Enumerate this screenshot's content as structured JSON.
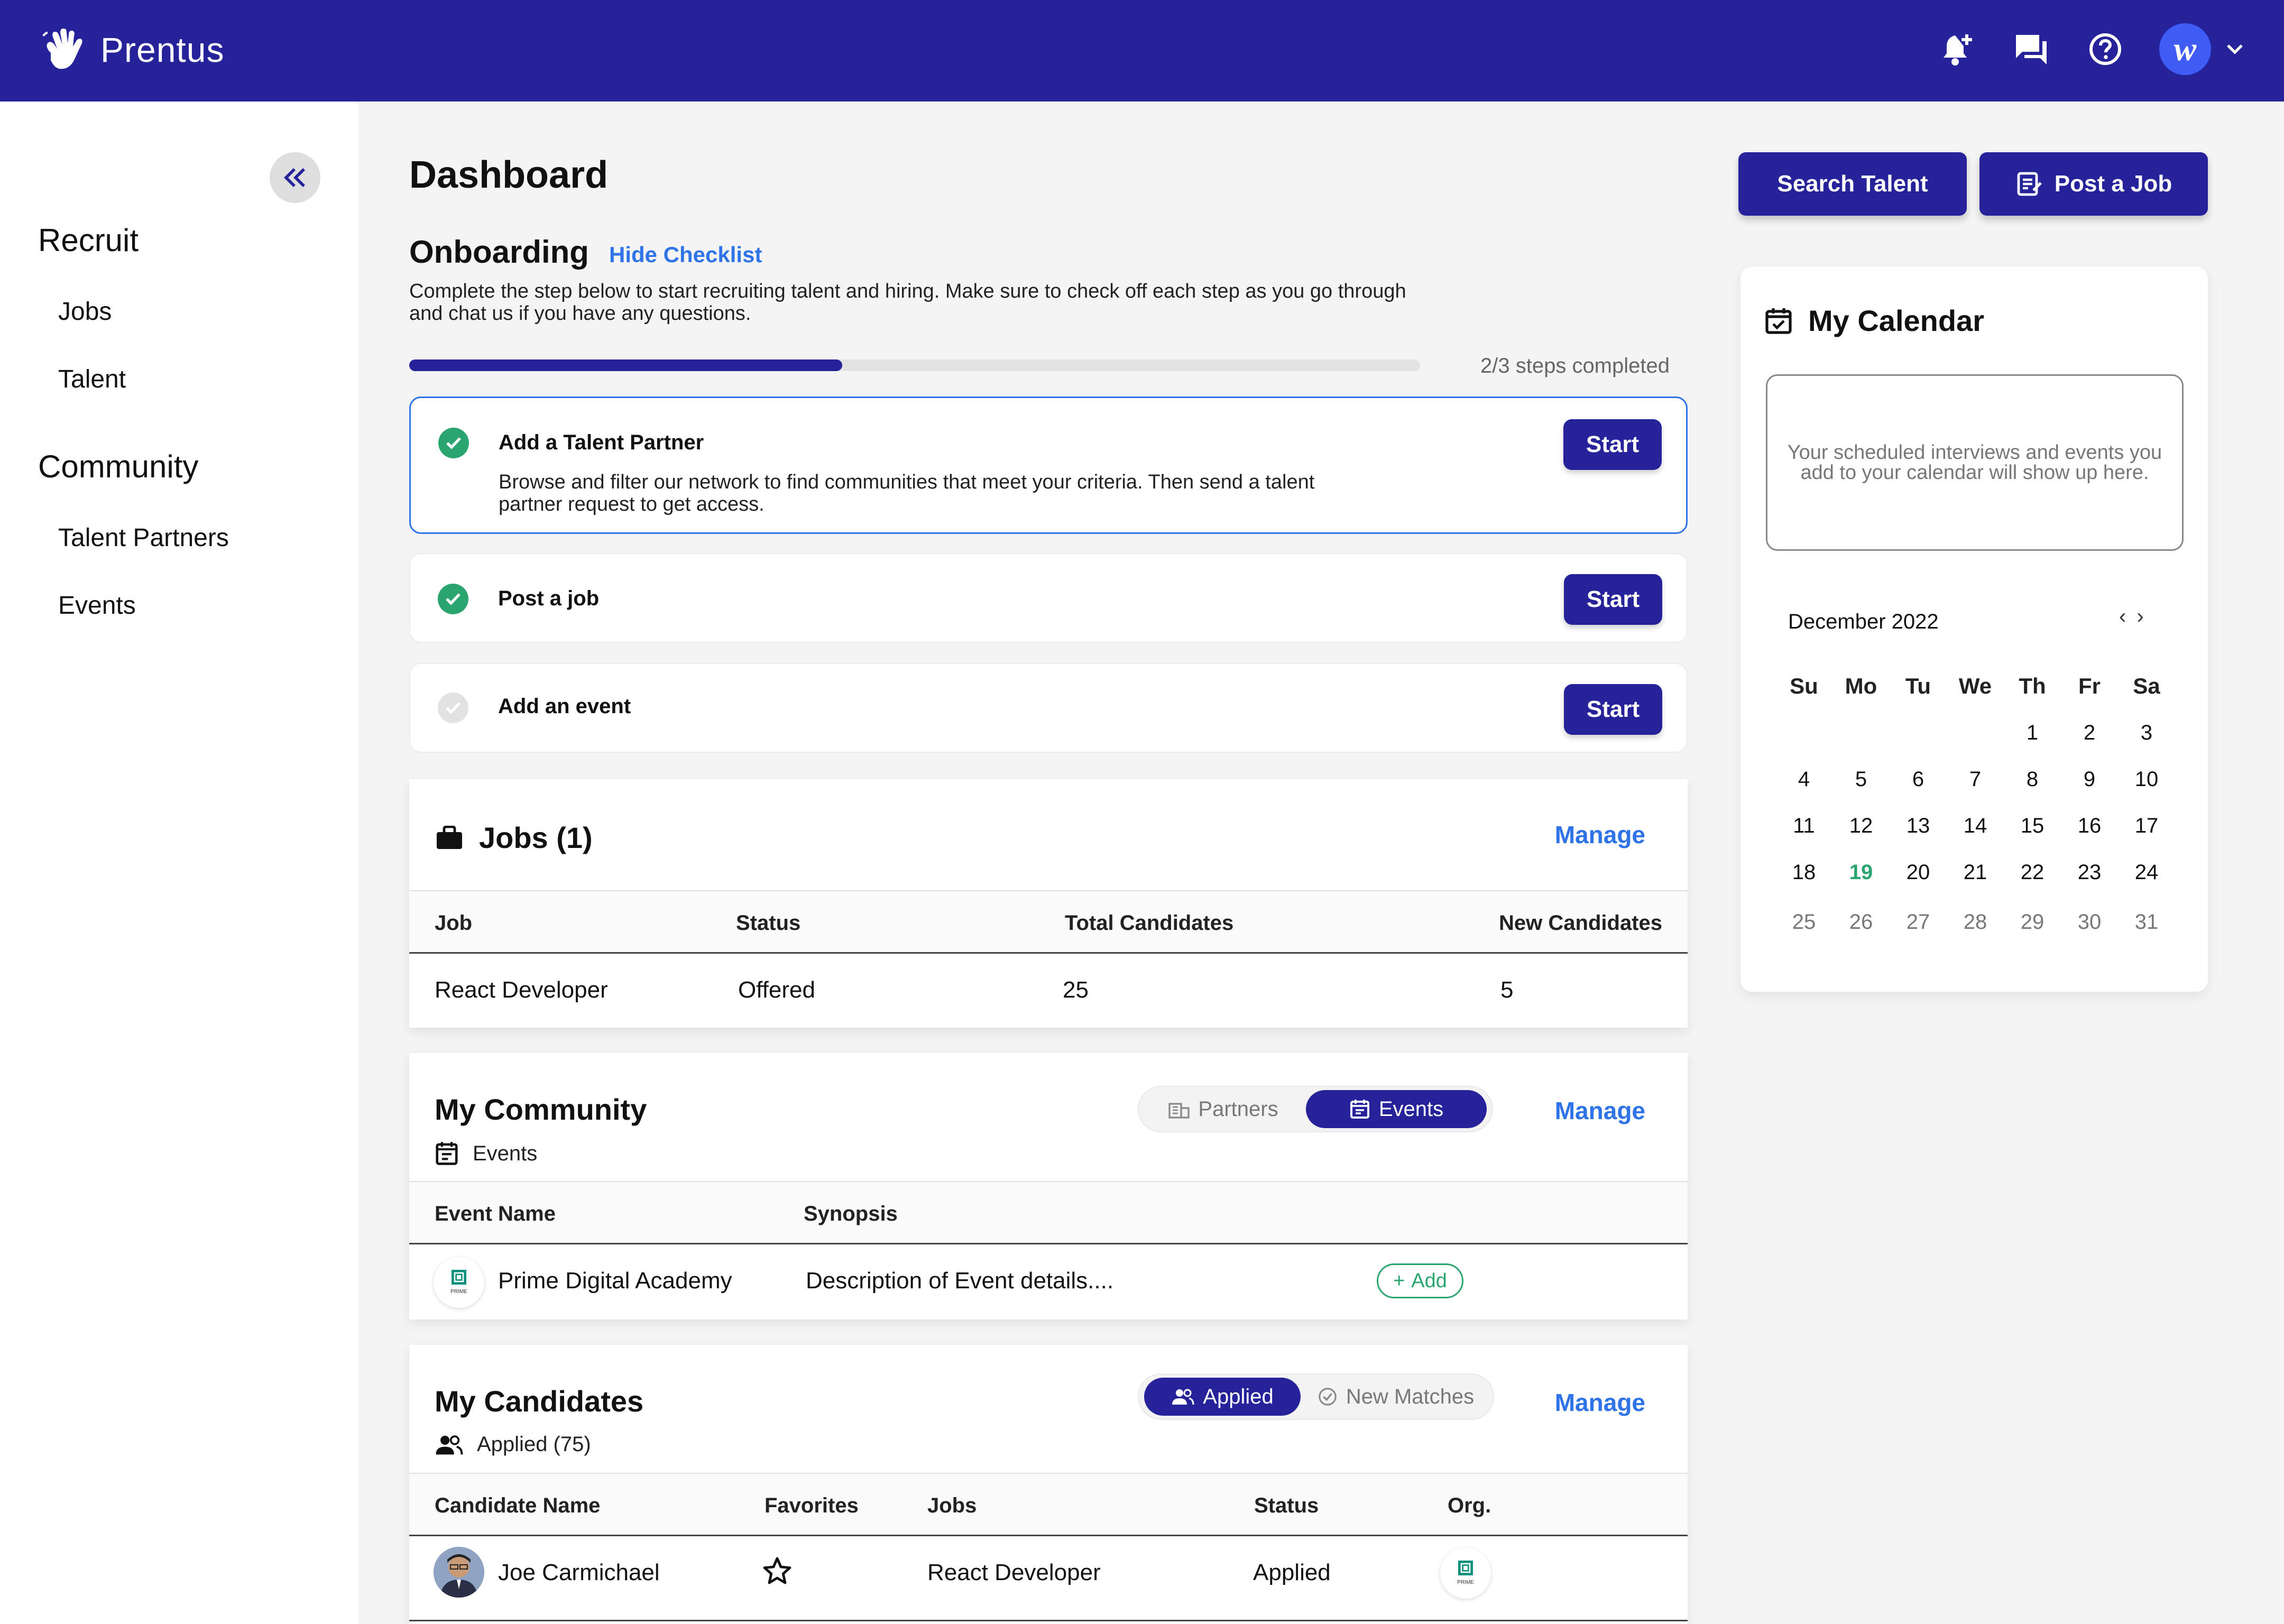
{
  "app": {
    "name": "Prentus",
    "avatar_letter": "w"
  },
  "topbar": {
    "icons": [
      "notification-add-icon",
      "chat-icon",
      "help-icon",
      "chevron-down-icon"
    ]
  },
  "sidebar": {
    "groups": [
      {
        "label": "Recruit",
        "items": [
          {
            "label": "Jobs"
          },
          {
            "label": "Talent"
          }
        ]
      },
      {
        "label": "Community",
        "items": [
          {
            "label": "Talent Partners"
          },
          {
            "label": "Events"
          }
        ]
      }
    ]
  },
  "page": {
    "title": "Dashboard",
    "search_talent": "Search Talent",
    "post_job": "Post a Job"
  },
  "onboarding": {
    "title": "Onboarding",
    "hide_label": "Hide Checklist",
    "description": "Complete the step below to start recruiting talent and hiring. Make sure to check off each step as you go through and chat us if you have any questions.",
    "progress_fraction": 0.4286,
    "progress_text": "2/3 steps completed",
    "steps": [
      {
        "title": "Add a Talent Partner",
        "description": "Browse and filter our network to find communities that meet your criteria. Then send a talent partner request to get access.",
        "done": true,
        "button": "Start"
      },
      {
        "title": "Post a job",
        "description": "",
        "done": true,
        "button": "Start"
      },
      {
        "title": "Add an event",
        "description": "",
        "done": false,
        "button": "Start"
      }
    ]
  },
  "jobs": {
    "title": "Jobs (1)",
    "manage": "Manage",
    "columns": [
      "Job",
      "Status",
      "Total Candidates",
      "New Candidates"
    ],
    "rows": [
      [
        "React Developer",
        "Offered",
        "25",
        "5"
      ]
    ]
  },
  "community": {
    "title": "My Community",
    "manage": "Manage",
    "toggle": {
      "partners": "Partners",
      "events": "Events",
      "selected": "Events"
    },
    "sub_label": "Events",
    "columns": [
      "Event Name",
      "Synopsis"
    ],
    "rows": [
      {
        "name": "Prime Digital Academy",
        "synopsis": "Description of Event details....",
        "action": "Add",
        "logo_text": "PRIME"
      }
    ]
  },
  "candidates": {
    "title": "My Candidates",
    "manage": "Manage",
    "toggle": {
      "applied": "Applied",
      "new_matches": "New Matches",
      "selected": "Applied"
    },
    "sub_label": "Applied (75)",
    "columns": [
      "Candidate Name",
      "Favorites",
      "Jobs",
      "Status",
      "Org."
    ],
    "rows": [
      {
        "name": "Joe Carmichael",
        "job": "React Developer",
        "status": "Applied",
        "org_logo_text": "PRIME"
      }
    ]
  },
  "calendar": {
    "title": "My Calendar",
    "empty_text": "Your scheduled interviews and events you add to your calendar will show up here.",
    "month": "December 2022",
    "prev": "‹",
    "next": "›",
    "weekdays": [
      "Su",
      "Mo",
      "Tu",
      "We",
      "Th",
      "Fr",
      "Sa"
    ],
    "weeks": [
      [
        "",
        "",
        "",
        "",
        "1",
        "2",
        "3"
      ],
      [
        "4",
        "5",
        "6",
        "7",
        "8",
        "9",
        "10"
      ],
      [
        "11",
        "12",
        "13",
        "14",
        "15",
        "16",
        "17"
      ],
      [
        "18",
        "19",
        "20",
        "21",
        "22",
        "23",
        "24"
      ],
      [
        "25",
        "26",
        "27",
        "28",
        "29",
        "30",
        "31"
      ]
    ],
    "today": "19"
  },
  "colors": {
    "brand": "#25229a",
    "accent": "#2e73e8",
    "success": "#2aa56f"
  }
}
